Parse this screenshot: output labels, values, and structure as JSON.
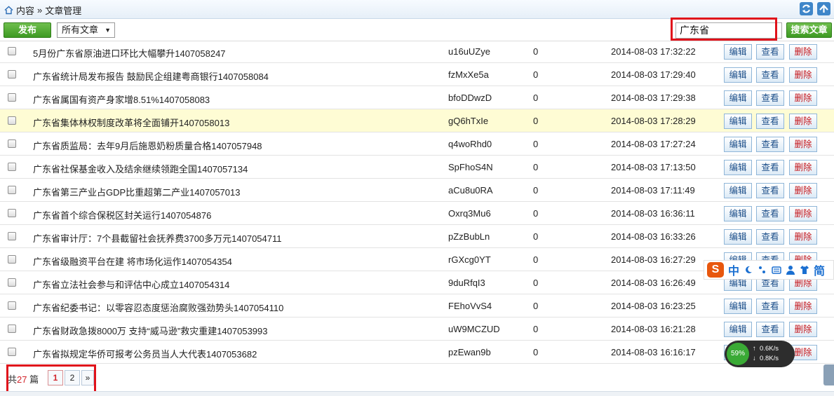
{
  "breadcrumb": {
    "home": "内容",
    "sep": "»",
    "current": "文章管理"
  },
  "toolbar": {
    "publish": "发布",
    "filter_value": "所有文章",
    "search_value": "广东省",
    "search_button": "搜索文章"
  },
  "actions": {
    "edit": "编辑",
    "view": "查看",
    "delete": "删除"
  },
  "rows": [
    {
      "title": "5月份广东省原油进口环比大幅攀升1407058247",
      "code": "u16uUZye",
      "count": "0",
      "date": "2014-08-03 17:32:22"
    },
    {
      "title": "广东省统计局发布报告 鼓励民企组建粤商银行1407058084",
      "code": "fzMxXe5a",
      "count": "0",
      "date": "2014-08-03 17:29:40"
    },
    {
      "title": "广东省属国有资产身家增8.51%1407058083",
      "code": "bfoDDwzD",
      "count": "0",
      "date": "2014-08-03 17:29:38"
    },
    {
      "title": "广东省集体林权制度改革将全面铺开1407058013",
      "code": "gQ6hTxIe",
      "count": "0",
      "date": "2014-08-03 17:28:29"
    },
    {
      "title": "广东省质监局：去年9月后施恩奶粉质量合格1407057948",
      "code": "q4woRhd0",
      "count": "0",
      "date": "2014-08-03 17:27:24"
    },
    {
      "title": "广东省社保基金收入及结余继续领跑全国1407057134",
      "code": "SpFhoS4N",
      "count": "0",
      "date": "2014-08-03 17:13:50"
    },
    {
      "title": "广东省第三产业占GDP比重超第二产业1407057013",
      "code": "aCu8u0RA",
      "count": "0",
      "date": "2014-08-03 17:11:49"
    },
    {
      "title": "广东省首个综合保税区封关运行1407054876",
      "code": "Oxrq3Mu6",
      "count": "0",
      "date": "2014-08-03 16:36:11"
    },
    {
      "title": "广东省审计厅：7个县截留社会抚养费3700多万元1407054711",
      "code": "pZzBubLn",
      "count": "0",
      "date": "2014-08-03 16:33:26"
    },
    {
      "title": "广东省级融资平台在建 将市场化运作1407054354",
      "code": "rGXcg0YT",
      "count": "0",
      "date": "2014-08-03 16:27:29"
    },
    {
      "title": "广东省立法社会参与和评估中心成立1407054314",
      "code": "9duRfqI3",
      "count": "0",
      "date": "2014-08-03 16:26:49"
    },
    {
      "title": "广东省纪委书记：以零容忍态度惩治腐败强劲势头1407054110",
      "code": "FEhoVvS4",
      "count": "0",
      "date": "2014-08-03 16:23:25"
    },
    {
      "title": "广东省财政急拨8000万 支持“威马逊”救灾重建1407053993",
      "code": "uW9MCZUD",
      "count": "0",
      "date": "2014-08-03 16:21:28"
    },
    {
      "title": "广东省拟规定华侨可报考公务员当人大代表1407053682",
      "code": "pzEwan9b",
      "count": "0",
      "date": "2014-08-03 16:16:17"
    }
  ],
  "highlight_row": 3,
  "pager": {
    "prefix": "共",
    "total": "27",
    "suffix": "篇",
    "pages": [
      "1",
      "2"
    ],
    "next": "»",
    "current_page": "1"
  },
  "ime": {
    "logo": "S",
    "mode": "中",
    "simplified": "简"
  },
  "net": {
    "percent": "59%",
    "up": "0.6K/s",
    "down": "0.8K/s"
  },
  "colors": {
    "accent_green": "#3d9a22",
    "highlight_row": "#fefcd4",
    "annotation_red": "#e0121b"
  }
}
